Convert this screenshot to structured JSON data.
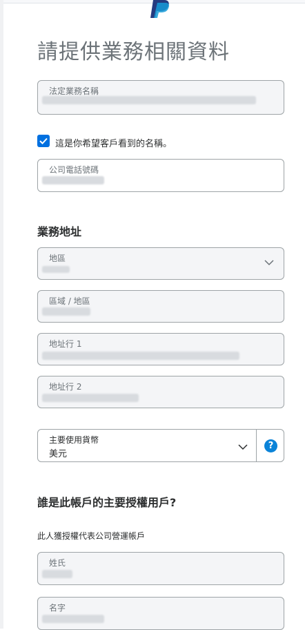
{
  "page": {
    "title": "請提供業務相關資料"
  },
  "business_name": {
    "label": "法定業務名稱"
  },
  "display_name_checkbox": {
    "checked": true,
    "label": "這是你希望客戶看到的名稱。"
  },
  "company_phone": {
    "label": "公司電話號碼"
  },
  "business_address": {
    "heading": "業務地址",
    "region": {
      "label": "地區"
    },
    "area": {
      "label": "區域 / 地區"
    },
    "address_line_1": {
      "label": "地址行 1"
    },
    "address_line_2": {
      "label": "地址行 2"
    }
  },
  "currency": {
    "label": "主要使用貨幣",
    "value": "美元",
    "help_label": "?"
  },
  "authorized_user": {
    "heading": "誰是此帳戶的主要授權用戶?",
    "description": "此人獲授權代表公司營運帳戶",
    "last_name": {
      "label": "姓氏"
    },
    "first_name": {
      "label": "名字"
    }
  },
  "colors": {
    "accent": "#0070e0",
    "help": "#0a83d8",
    "border": "#9da3a6",
    "field_bg": "#f4f5f7"
  }
}
